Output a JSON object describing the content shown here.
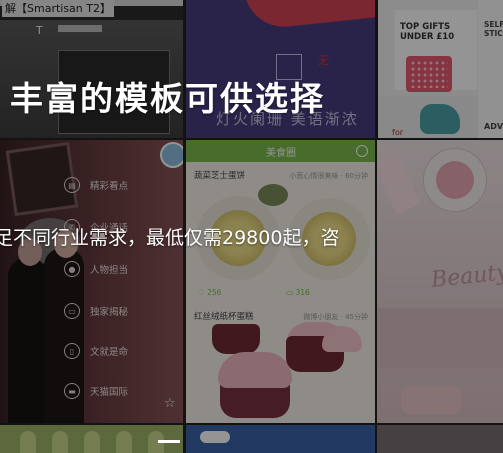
{
  "headline": "丰富的模板可供选择",
  "subline": "足不同行业需求，最低仅需29800起，咨",
  "tiles": {
    "phone": {
      "title": "解【Smartisan T2】",
      "icon_label": "T"
    },
    "purple": {
      "subtitle": "灯火阑珊 美语渐浓",
      "seal_char": "无"
    },
    "gifts": {
      "top_gifts": "TOP GIFTS\nUNDER £10",
      "selfie": "SELFIE\nSTICK",
      "adv": "ADV",
      "for": "for"
    },
    "app_menu": {
      "items": [
        {
          "label": "精彩看点",
          "icon": "book-icon"
        },
        {
          "label": "企业通话",
          "icon": "phone-icon"
        },
        {
          "label": "人物担当",
          "icon": "person-icon"
        },
        {
          "label": "独家揭秘",
          "icon": "doc-icon"
        },
        {
          "label": "文就是命",
          "icon": "text-icon"
        },
        {
          "label": "天猫国际",
          "icon": "mall-icon"
        }
      ]
    },
    "recipe": {
      "bar_title": "美食圈",
      "row1_label": "蔬菜芝士蛋饼",
      "row1_right": "小葱心情很美味 · 60分钟",
      "likes": "♡ 256",
      "comments": "▭ 316",
      "row2_label": "红丝绒纸杯蛋糕",
      "row2_right": "微博小朋友 · 45分钟"
    },
    "pink": {
      "script": "Beauty"
    }
  },
  "colors": {
    "recipe_green": "#7abb4c",
    "purple": "#473b7e",
    "overlay": "rgba(0,0,0,0.42)"
  }
}
